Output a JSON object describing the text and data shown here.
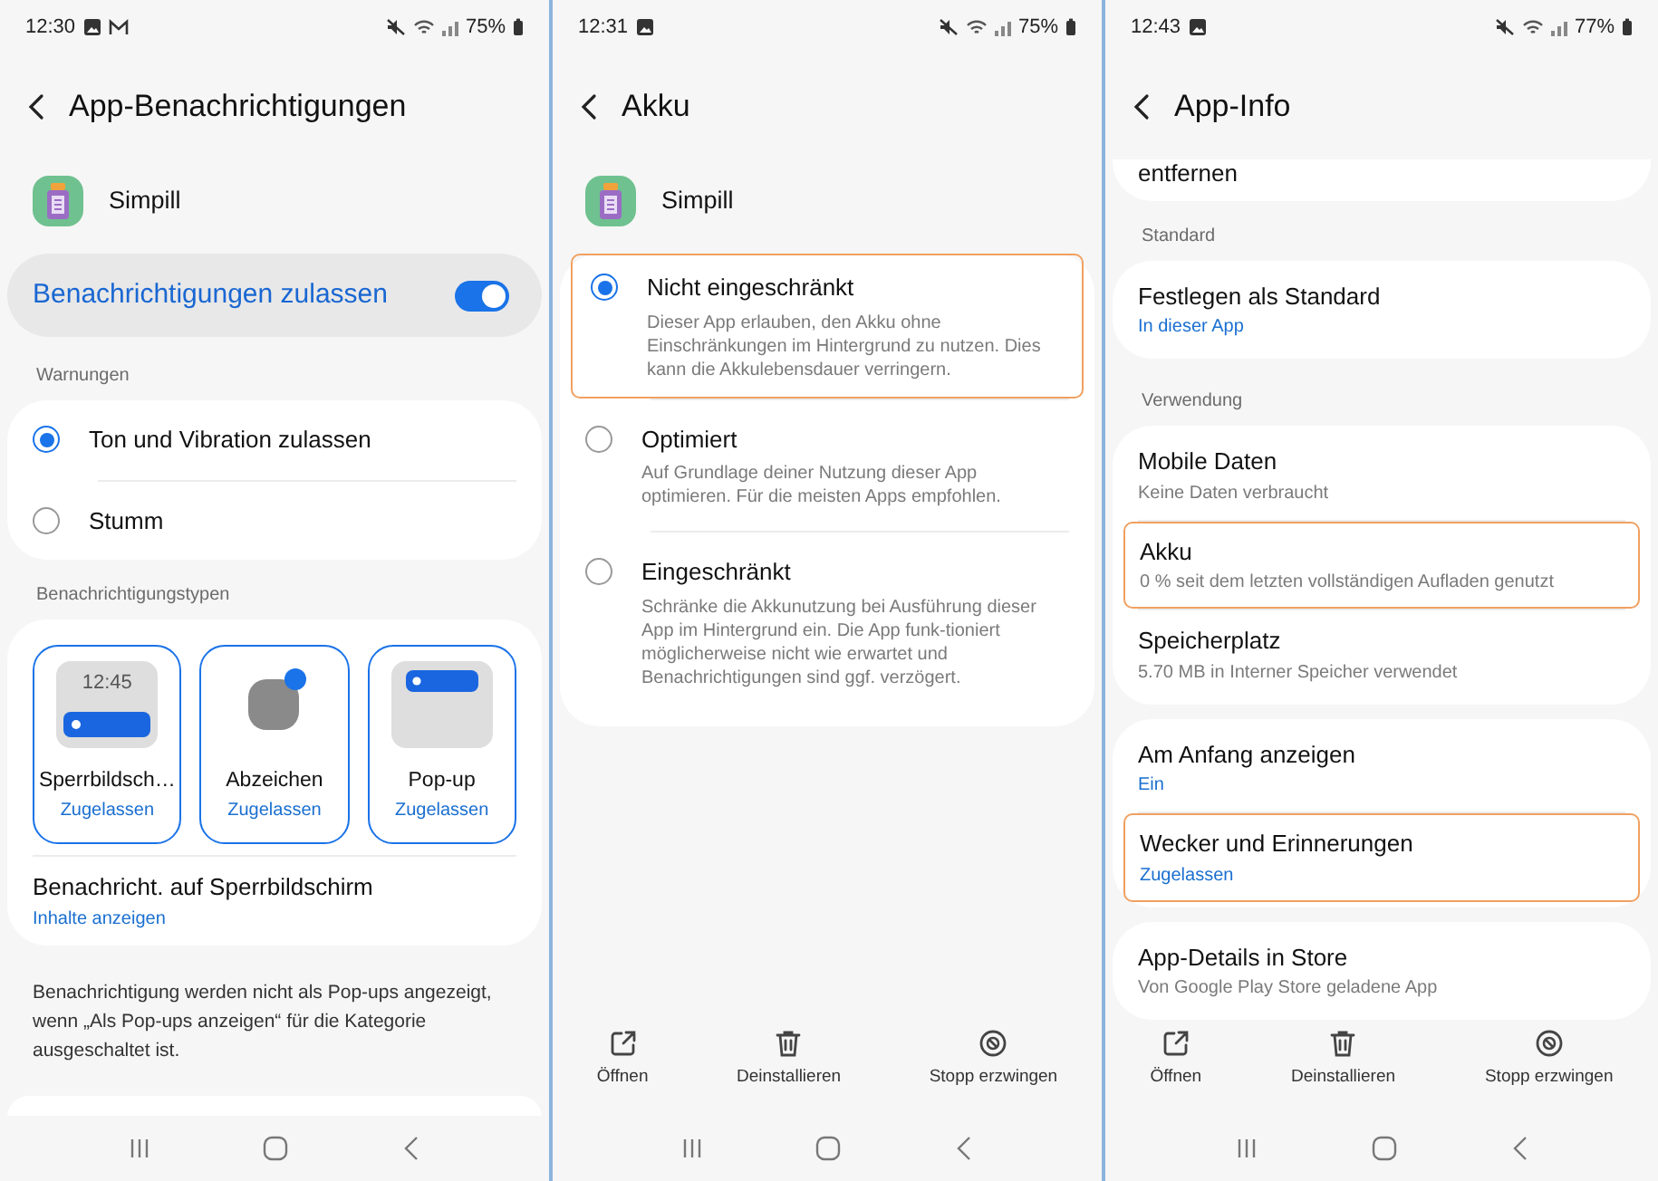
{
  "screens": [
    {
      "status": {
        "time": "12:30",
        "icons": [
          {
            "kind": "picture"
          },
          {
            "kind": "mail"
          }
        ],
        "battery": "75%"
      },
      "title": "App-Benachrichtigungen",
      "app": {
        "name": "Simpill"
      },
      "sections": [
        {
          "kind": "toggle",
          "label": "Benachrichtigungen zulassen",
          "on": true
        },
        {
          "kind": "radios",
          "header": "Warnungen",
          "items": [
            {
              "title": "Ton und Vibration zulassen",
              "selected": true
            },
            {
              "title": "Stumm",
              "selected": false
            }
          ]
        },
        {
          "kind": "tiles",
          "header": "Benachrichtigungstypen",
          "tiles": [
            {
              "kind": "lockscreen",
              "time": "12:45",
              "label": "Sperrbildsch…",
              "status": "Zugelassen",
              "selected": true
            },
            {
              "kind": "badge",
              "label": "Abzeichen",
              "status": "Zugelassen",
              "selected": true
            },
            {
              "kind": "popup",
              "label": "Pop-up",
              "status": "Zugelassen",
              "selected": true
            }
          ],
          "items": [
            {
              "title": "Benachricht. auf Sperrbildschirm",
              "subtitle": "Inhalte anzeigen",
              "subtitle_accent": true
            }
          ]
        },
        {
          "kind": "note",
          "text": "Benachrichtigung werden nicht als Pop-ups angezeigt, wenn „Als Pop-ups anzeigen“ für die Kategorie ausgeschaltet ist."
        },
        {
          "kind": "stub"
        }
      ]
    },
    {
      "status": {
        "time": "12:31",
        "icons": [
          {
            "kind": "picture"
          }
        ],
        "battery": "75%"
      },
      "title": "Akku",
      "app": {
        "name": "Simpill"
      },
      "sections": [
        {
          "kind": "radios",
          "items": [
            {
              "title": "Nicht eingeschränkt",
              "description": "Dieser App erlauben, den Akku ohne Einschränkungen im Hintergrund zu nutzen. Dies kann die Akkulebensdauer verringern.",
              "selected": true,
              "highlighted": true
            },
            {
              "title": "Optimiert",
              "description": "Auf Grundlage deiner Nutzung dieser App optimieren. Für die meisten Apps empfohlen.",
              "selected": false,
              "highlighted": false
            },
            {
              "title": "Eingeschränkt",
              "description": "Schränke die Akkunutzung bei Ausführung dieser App im Hintergrund ein. Die App funk-tioniert möglicherweise nicht wie erwartet und Benachrichtigungen sind ggf. verzögert.",
              "selected": false,
              "highlighted": false
            }
          ]
        }
      ],
      "actions": [
        {
          "kind": "open",
          "label": "Öffnen"
        },
        {
          "kind": "trash",
          "label": "Deinstallieren"
        },
        {
          "kind": "stop",
          "label": "Stopp erzwingen"
        }
      ]
    },
    {
      "status": {
        "time": "12:43",
        "icons": [
          {
            "kind": "picture"
          }
        ],
        "battery": "77%"
      },
      "title": "App-Info",
      "sections": [
        {
          "kind": "partial",
          "text": "entfernen"
        },
        {
          "kind": "list",
          "header": "Standard",
          "items": [
            {
              "title": "Festlegen als Standard",
              "subtitle": "In dieser App",
              "subtitle_accent": true,
              "highlighted": false
            }
          ]
        },
        {
          "kind": "list",
          "header": "Verwendung",
          "items": [
            {
              "title": "Mobile Daten",
              "subtitle": "Keine Daten verbraucht",
              "subtitle_accent": false,
              "highlighted": false
            },
            {
              "title": "Akku",
              "subtitle": "0 % seit dem letzten vollständigen Aufladen genutzt",
              "subtitle_accent": false,
              "highlighted": true
            },
            {
              "title": "Speicherplatz",
              "subtitle": "5.70 MB in Interner Speicher verwendet",
              "subtitle_accent": false,
              "highlighted": false
            }
          ]
        },
        {
          "kind": "list",
          "items": [
            {
              "title": "Am Anfang anzeigen",
              "subtitle": "Ein",
              "subtitle_accent": true,
              "highlighted": false
            },
            {
              "title": "Wecker und Erinnerungen",
              "subtitle": "Zugelassen",
              "subtitle_accent": true,
              "highlighted": true
            }
          ]
        },
        {
          "kind": "list",
          "items": [
            {
              "title": "App-Details in Store",
              "subtitle": "Von Google Play Store geladene App",
              "subtitle_accent": false,
              "highlighted": false
            }
          ]
        }
      ],
      "actions": [
        {
          "kind": "open",
          "label": "Öffnen"
        },
        {
          "kind": "trash",
          "label": "Deinstallieren"
        },
        {
          "kind": "stop",
          "label": "Stopp erzwingen"
        }
      ]
    }
  ]
}
